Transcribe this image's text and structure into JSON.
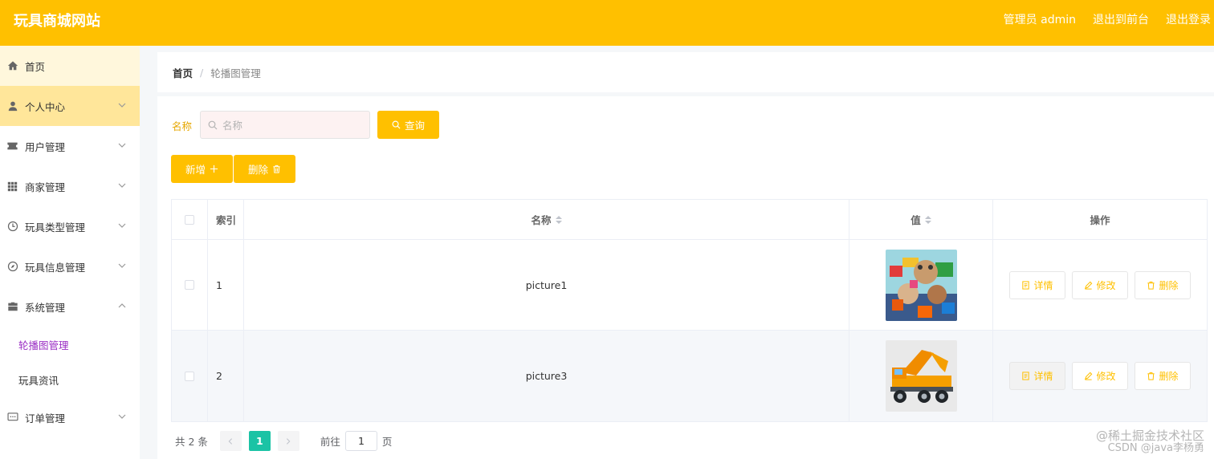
{
  "header": {
    "brand": "玩具商城网站",
    "admin": "管理员 admin",
    "back_front": "退出到前台",
    "logout": "退出登录"
  },
  "sidebar": {
    "items": [
      {
        "label": "首页",
        "icon": "home-icon"
      },
      {
        "label": "个人中心",
        "icon": "user-icon"
      },
      {
        "label": "用户管理",
        "icon": "ticket-icon"
      },
      {
        "label": "商家管理",
        "icon": "grid-icon"
      },
      {
        "label": "玩具类型管理",
        "icon": "clock-icon"
      },
      {
        "label": "玩具信息管理",
        "icon": "compass-icon"
      },
      {
        "label": "系统管理",
        "icon": "briefcase-icon"
      }
    ],
    "sub_items": [
      {
        "label": "轮播图管理"
      },
      {
        "label": "玩具资讯"
      }
    ],
    "order": {
      "label": "订单管理",
      "icon": "chat-icon"
    }
  },
  "breadcrumb": {
    "home": "首页",
    "sep": "/",
    "current": "轮播图管理"
  },
  "search": {
    "label": "名称",
    "placeholder": "名称",
    "query_button": "查询"
  },
  "actions": {
    "add": "新增",
    "delete": "删除"
  },
  "table": {
    "headers": {
      "index": "索引",
      "name": "名称",
      "value": "值",
      "ops": "操作"
    },
    "rows": [
      {
        "index": "1",
        "name": "picture1"
      },
      {
        "index": "2",
        "name": "picture3"
      }
    ],
    "op_labels": {
      "detail": "详情",
      "edit": "修改",
      "delete": "删除"
    }
  },
  "pagination": {
    "total": "共 2 条",
    "current_page": "1",
    "goto_label": "前往",
    "goto_value": "1",
    "page_suffix": "页"
  },
  "watermark": {
    "line1": "@稀土掘金技术社区",
    "line2": "CSDN @java李杨勇"
  },
  "colors": {
    "accent": "#FFC000",
    "pager_active": "#1BC3A5",
    "submenu_active": "#9B2FC4"
  }
}
